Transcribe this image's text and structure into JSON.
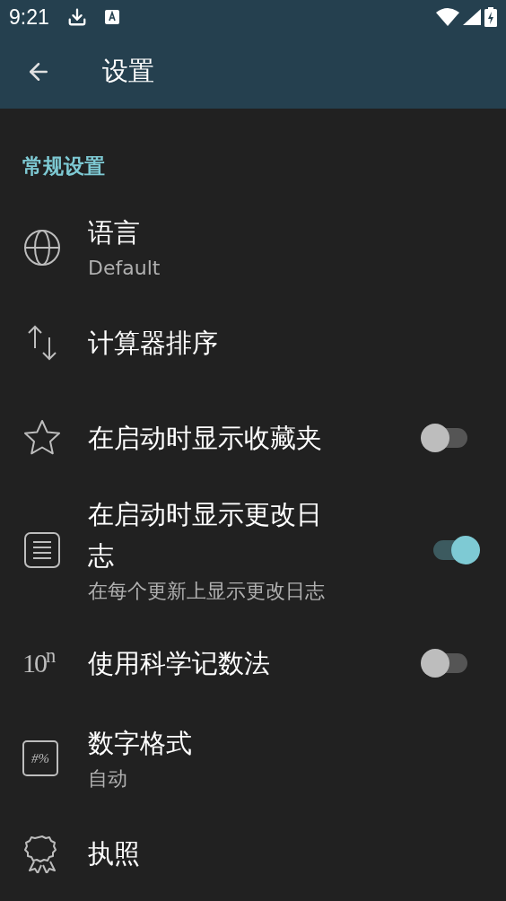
{
  "status_bar": {
    "time": "9:21"
  },
  "app_bar": {
    "title": "设置"
  },
  "section": {
    "title": "常规设置"
  },
  "items": [
    {
      "kind": "plain",
      "title": "语言",
      "subtitle": "Default"
    },
    {
      "kind": "plain",
      "title": "计算器排序"
    },
    {
      "kind": "toggle",
      "title": "在启动时显示收藏夹",
      "on": false
    },
    {
      "kind": "toggle",
      "title": "在启动时显示更改日志",
      "subtitle": "在每个更新上显示更改日志",
      "on": true
    },
    {
      "kind": "toggle",
      "title": "使用科学记数法",
      "on": false,
      "icon_text": "10$^{n}$"
    },
    {
      "kind": "plain",
      "title": "数字格式",
      "subtitle": "自动",
      "icon_text": "#%"
    },
    {
      "kind": "plain",
      "title": "执照"
    }
  ]
}
